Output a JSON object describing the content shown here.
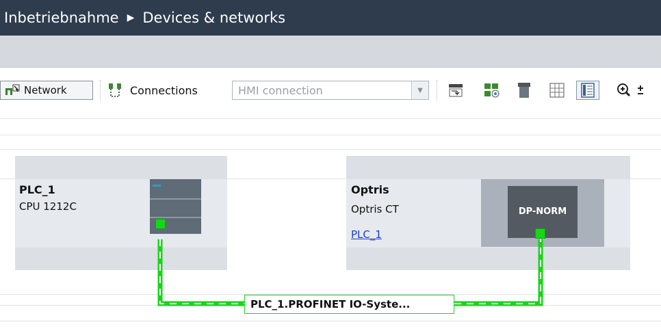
{
  "title": {
    "project": "Inbetriebnahme",
    "page": "Devices & networks"
  },
  "toolbar": {
    "network_label": "Network",
    "connections_label": "Connections",
    "connection_type": {
      "value": "HMI connection"
    }
  },
  "devices": [
    {
      "name": "PLC_1",
      "type": "CPU 1212C"
    },
    {
      "name": "Optris",
      "type": "Optris CT",
      "assigned_to": "PLC_1",
      "module_label": "DP-NORM"
    }
  ],
  "network": {
    "label": "PLC_1.PROFINET IO-Syste...",
    "color": "#17d617"
  },
  "colors": {
    "titlebar": "#2e3c4e",
    "device_bg": "#e6e9ed",
    "link": "#1a3fd0"
  },
  "icons": [
    "network-icon",
    "connections-icon",
    "dropdown-arrow-icon",
    "device-name-icon",
    "device-tree-icon",
    "module-icon",
    "grid-icon",
    "properties-panel-icon",
    "zoom-icon"
  ]
}
